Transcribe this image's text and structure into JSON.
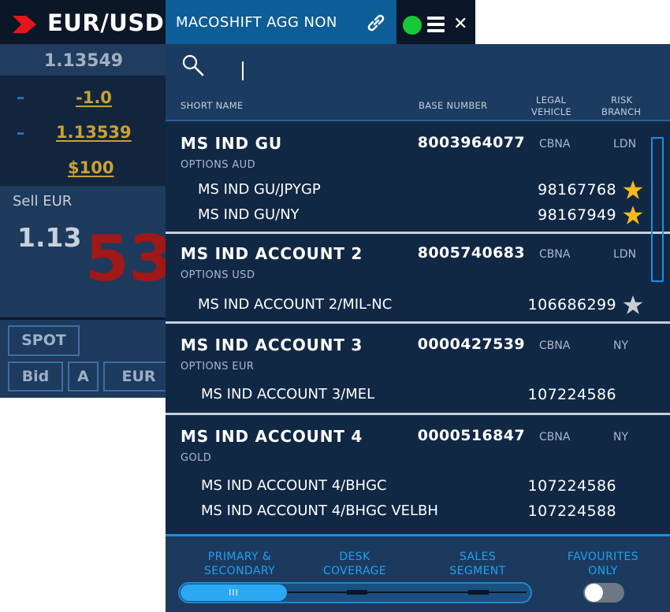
{
  "fx_tile": {
    "pair": "EUR/USD",
    "mid_rate": "1.13549",
    "spread": "-1.0",
    "rate": "1.13539",
    "amount": "$100",
    "sell_label": "Sell EUR",
    "sell_price_small": "1.13",
    "sell_price_big": "53",
    "spot_button": "SPOT",
    "bid_button": "Bid",
    "a_button": "A",
    "eur_button": "EUR",
    "colors": {
      "header_bg": "#0b1626",
      "accent_red": "#a01818",
      "gold": "#c9a233"
    }
  },
  "panel": {
    "title": "MACOSHIFT AGG NON",
    "status_color": "#16c936",
    "icons": {
      "link": "link-icon",
      "status": "status-dot-icon",
      "menu": "hamburger-menu-icon",
      "close": "close-icon",
      "search": "search-icon",
      "star": "star-icon"
    },
    "search": {
      "placeholder": ""
    },
    "columns": {
      "short_name": "SHORT NAME",
      "base_number": "BASE NUMBER",
      "legal_vehicle_1": "LEGAL",
      "legal_vehicle_2": "VEHICLE",
      "risk_branch_1": "RISK",
      "risk_branch_2": "BRANCH"
    },
    "accounts": [
      {
        "name": "MS IND GU",
        "base_number": "8003964077",
        "legal_vehicle": "CBNA",
        "risk_branch": "LDN",
        "product": "OPTIONS AUD",
        "subaccounts": [
          {
            "name": "MS IND GU/JPYGP",
            "number": "98167768",
            "favourite": true
          },
          {
            "name": "MS IND GU/NY",
            "number": "98167949",
            "favourite": true
          }
        ]
      },
      {
        "name": "MS IND ACCOUNT 2",
        "base_number": "8005740683",
        "legal_vehicle": "CBNA",
        "risk_branch": "LDN",
        "product": "OPTIONS USD",
        "subaccounts": [
          {
            "name": "MS IND ACCOUNT 2/MIL-NC",
            "number": "106686299",
            "favourite": false
          }
        ]
      },
      {
        "name": "MS IND ACCOUNT 3",
        "base_number": "0000427539",
        "legal_vehicle": "CBNA",
        "risk_branch": "NY",
        "product": "OPTIONS EUR",
        "subaccounts": [
          {
            "name": "MS IND ACCOUNT 3/MEL",
            "number": "107224586"
          }
        ]
      },
      {
        "name": "MS IND ACCOUNT 4",
        "base_number": "0000516847",
        "legal_vehicle": "CBNA",
        "risk_branch": "NY",
        "product": "GOLD",
        "subaccounts": [
          {
            "name": "MS IND ACCOUNT 4/BHGC",
            "number": "107224586"
          },
          {
            "name": "MS IND ACCOUNT 4/BHGC VELBH",
            "number": "107224588"
          }
        ]
      }
    ],
    "footer": {
      "primary_1": "PRIMARY &",
      "primary_2": "SECONDARY",
      "desk_1": "DESK",
      "desk_2": "COVERAGE",
      "sales_1": "SALES",
      "sales_2": "SEGMENT",
      "fav_1": "FAVOURITES",
      "fav_2": "ONLY",
      "slider_grip": "III",
      "favourites_only_on": false
    },
    "star_colors": {
      "on": "#f6b91d",
      "off": "#c8cdd4"
    }
  }
}
